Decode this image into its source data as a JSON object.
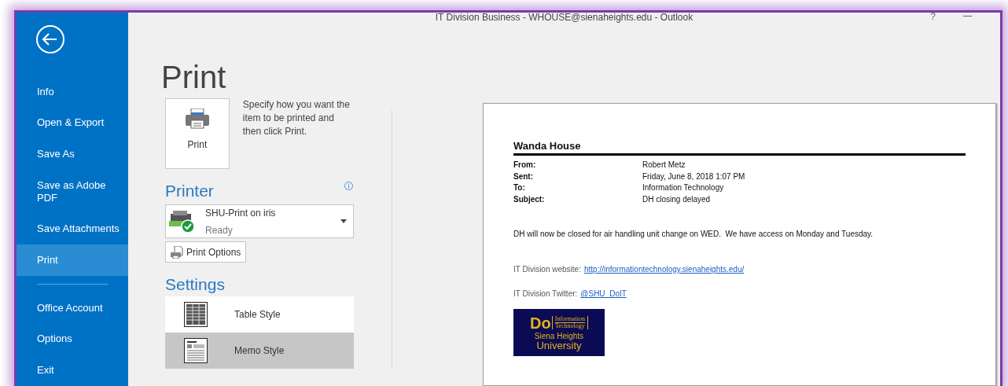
{
  "window": {
    "title": "IT Division Business - WHOUSE@sienaheights.edu - Outlook",
    "help": "?"
  },
  "sidebar": {
    "items": [
      {
        "label": "Info",
        "selected": false
      },
      {
        "label": "Open & Export",
        "selected": false
      },
      {
        "label": "Save As",
        "selected": false
      },
      {
        "label": "Save as Adobe PDF",
        "selected": false
      },
      {
        "label": "Save Attachments",
        "selected": false
      },
      {
        "label": "Print",
        "selected": true
      }
    ],
    "account_items": [
      {
        "label": "Office Account",
        "selected": false
      },
      {
        "label": "Options",
        "selected": false
      },
      {
        "label": "Exit",
        "selected": false
      }
    ]
  },
  "page_title": "Print",
  "print_button": {
    "label": "Print",
    "description": "Specify how you want the item to be printed and then click Print."
  },
  "printer": {
    "heading": "Printer",
    "name": "SHU-Print on iris",
    "status": "Ready",
    "options_button": "Print Options"
  },
  "settings": {
    "heading": "Settings",
    "styles": [
      {
        "label": "Table Style",
        "kind": "table",
        "selected": false
      },
      {
        "label": "Memo Style",
        "kind": "memo",
        "selected": true
      }
    ]
  },
  "preview": {
    "sender_heading": "Wanda House",
    "fields": [
      {
        "label": "From:",
        "value": "Robert Metz"
      },
      {
        "label": "Sent:",
        "value": "Friday, June 8, 2018 1:07 PM"
      },
      {
        "label": "To:",
        "value": "Information Technology"
      },
      {
        "label": "Subject:",
        "value": "DH closing delayed"
      }
    ],
    "body": "DH will now be closed for air handling unit change on WED.  We have access on Monday and Tuesday.",
    "links": [
      {
        "label": "IT Division website:",
        "link": "http://informationtechnology.sienaheights.edu/"
      },
      {
        "label": "IT Division Twitter:",
        "link": "@SHU_DoIT"
      }
    ],
    "logo": {
      "mark": "Do",
      "top": "Information",
      "bottom": "Technology",
      "line1": "Siena Heights",
      "line2": "University"
    }
  }
}
